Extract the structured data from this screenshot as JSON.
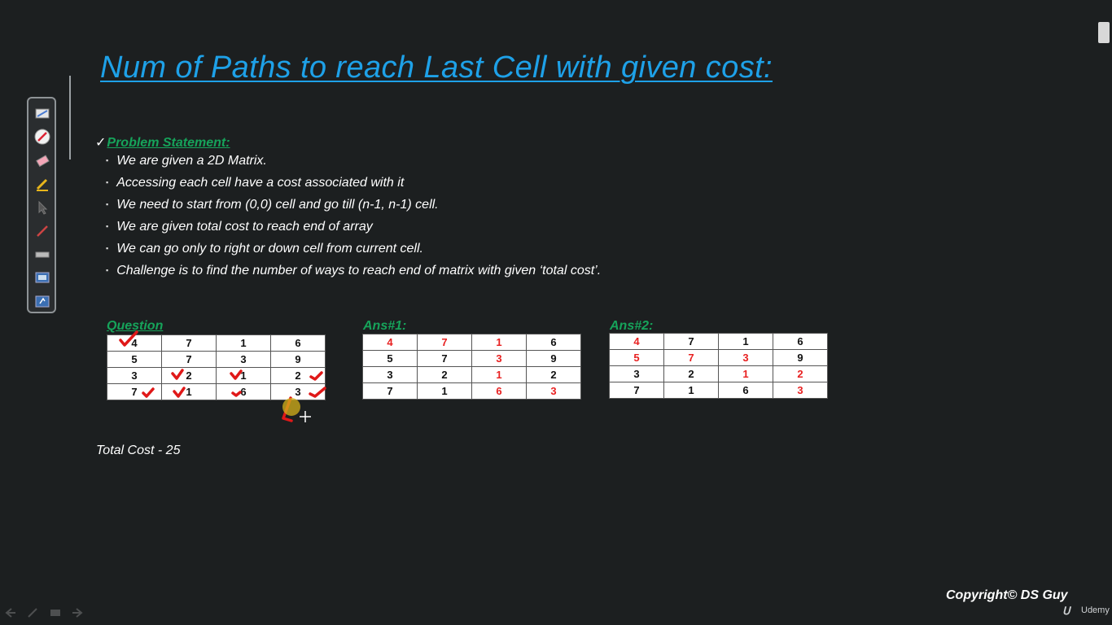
{
  "slide": {
    "title": "Num of Paths to reach Last Cell with given cost:",
    "problem_check": "✓",
    "problem_label": "Problem Statement:",
    "bullets": [
      "We are given a 2D Matrix.",
      "Accessing each cell have a cost associated with it",
      "We need to start from (0,0) cell and go till (n-1, n-1) cell.",
      "We are given total cost to reach end of array",
      "We can go only to right or down cell from current cell.",
      "Challenge is to find the number of ways to reach end of matrix with given ‘total cost’."
    ],
    "question_label": "Question",
    "ans1_label": "Ans#1:",
    "ans2_label": "Ans#2:",
    "total_cost": "Total Cost - 25",
    "copyright": "Copyright© DS Guy",
    "brand": "Udemy"
  },
  "matrices": {
    "question": [
      [
        "4",
        "7",
        "1",
        "6"
      ],
      [
        "5",
        "7",
        "3",
        "9"
      ],
      [
        "3",
        "2",
        "1",
        "2"
      ],
      [
        "7",
        "1",
        "6",
        "3"
      ]
    ],
    "ans1": [
      [
        "4",
        "7",
        "1",
        "6"
      ],
      [
        "5",
        "7",
        "3",
        "9"
      ],
      [
        "3",
        "2",
        "1",
        "2"
      ],
      [
        "7",
        "1",
        "6",
        "3"
      ]
    ],
    "ans2": [
      [
        "4",
        "7",
        "1",
        "6"
      ],
      [
        "5",
        "7",
        "3",
        "9"
      ],
      [
        "3",
        "2",
        "1",
        "2"
      ],
      [
        "7",
        "1",
        "6",
        "3"
      ]
    ]
  },
  "highlight": {
    "ans1": [
      [
        true,
        true,
        true,
        false
      ],
      [
        false,
        false,
        true,
        false
      ],
      [
        false,
        false,
        true,
        false
      ],
      [
        false,
        false,
        true,
        true
      ]
    ],
    "ans2": [
      [
        true,
        false,
        false,
        false
      ],
      [
        true,
        true,
        true,
        false
      ],
      [
        false,
        false,
        true,
        true
      ],
      [
        false,
        false,
        false,
        true
      ]
    ]
  },
  "colors": {
    "background": "#1c1f20",
    "title": "#1ea1e8",
    "label_green": "#16a35a",
    "path_red": "#e82020",
    "ink": "#e01818"
  },
  "toolbar": {
    "tools": [
      "pen-tool-icon",
      "highlighter-icon",
      "eraser-icon",
      "marker-icon",
      "pointer-icon",
      "brush-icon",
      "ruler-icon",
      "screen-capture-icon",
      "presentation-icon"
    ]
  }
}
